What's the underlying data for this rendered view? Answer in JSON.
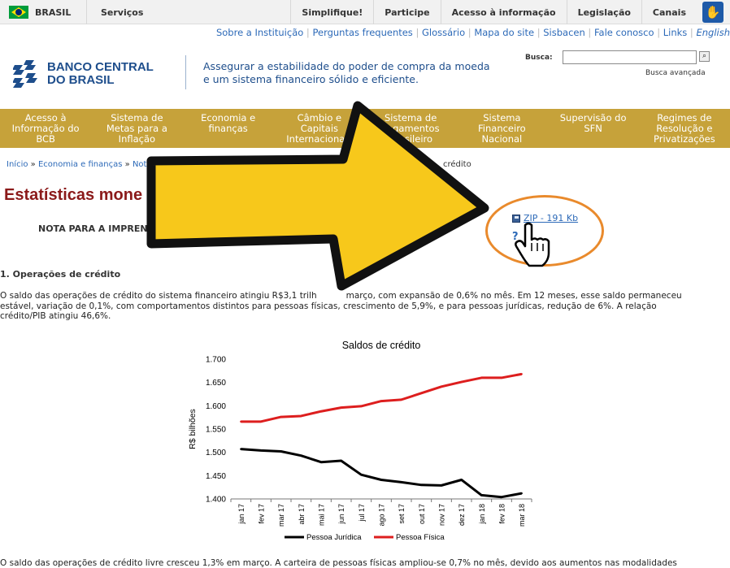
{
  "gov_bar": {
    "country": "BRASIL",
    "services": "Serviços",
    "links": [
      "Simplifique!",
      "Participe",
      "Acesso à informação",
      "Legislação",
      "Canais"
    ],
    "accessibility_icon": "vlibras-hand-icon"
  },
  "util_links": [
    "Sobre a Instituição",
    "Perguntas frequentes",
    "Glossário",
    "Mapa do site",
    "Sisbacen",
    "Fale conosco",
    "Links",
    "English"
  ],
  "header": {
    "logo_line1": "BANCO CENTRAL",
    "logo_line2": "DO BRASIL",
    "tagline_line1": "Assegurar a estabilidade do poder de compra da moeda",
    "tagline_line2": "e um sistema financeiro sólido e eficiente.",
    "search_label": "Busca:",
    "search_value": "",
    "search_advanced": "Busca avançada"
  },
  "main_nav": [
    [
      "Acesso à",
      "Informação do",
      "BCB"
    ],
    [
      "Sistema de",
      "Metas para a",
      "Inflação"
    ],
    [
      "Economia e",
      "finanças",
      ""
    ],
    [
      "Câmbio e",
      "Capitais",
      "Internacionais"
    ],
    [
      "Sistema de",
      "Pagamentos",
      "Brasileiro"
    ],
    [
      "Sistema",
      "Financeiro",
      "Nacional"
    ],
    [
      "Supervisão do",
      "SFN",
      ""
    ],
    [
      "Regimes de",
      "Resolução e",
      "Privatizações"
    ]
  ],
  "breadcrumb": {
    "items": [
      "Início",
      "Economia e finanças",
      "Nota"
    ],
    "tail": "crédito"
  },
  "page": {
    "title": "Estatísticas mone",
    "press_note": "NOTA PARA A IMPRENS",
    "zip_link": "ZIP - 191 Kb",
    "help": "?",
    "section1": "1. Operações de crédito",
    "para1_line1": "O saldo das operações de crédito do sistema financeiro atingiu R$3,1 trilh",
    "para1_line1b": "março, com expansão de 0,6% no mês. Em 12 meses, esse saldo permaneceu",
    "para1_line2": "estável, variação de 0,1%, com comportamentos distintos para pessoas f",
    "para1_line2b": "ísicas, crescimento de 5,9%, e para pessoas jurídicas, redução de 6%. A relação",
    "para1_line3": "crédito/PIB atingiu 46,6%.",
    "para2": "O saldo das operações de crédito livre cresceu 1,3% em março. A carteira de pessoas físicas ampliou-se 0,7% no mês, devido aos aumentos nas modalidades"
  },
  "colors": {
    "nav_gold": "#c6a23a",
    "title_red": "#8b1a1a",
    "link_blue": "#2d6ab8",
    "arrow_yellow": "#f7c81b",
    "ring_orange": "#e98a2c",
    "series_pj": "#000000",
    "series_pf": "#dd1e1e"
  },
  "chart_data": {
    "type": "line",
    "title": "Saldos de crédito",
    "ylabel": "R$ bilhões",
    "xlabel": "",
    "ylim": [
      1400,
      1700
    ],
    "yticks": [
      "1.400",
      "1.450",
      "1.500",
      "1.550",
      "1.600",
      "1.650",
      "1.700"
    ],
    "categories": [
      "jan 17",
      "fev 17",
      "mar 17",
      "abr 17",
      "mai 17",
      "jun 17",
      "jul 17",
      "ago 17",
      "set 17",
      "out 17",
      "nov 17",
      "dez 17",
      "jan 18",
      "fev 18",
      "mar 18"
    ],
    "series": [
      {
        "name": "Pessoa Jurídica",
        "values": [
          1507,
          1504,
          1502,
          1493,
          1479,
          1482,
          1452,
          1441,
          1436,
          1430,
          1429,
          1441,
          1408,
          1404,
          1412
        ]
      },
      {
        "name": "Pessoa Física",
        "values": [
          1566,
          1566,
          1576,
          1578,
          1588,
          1596,
          1599,
          1610,
          1613,
          1627,
          1641,
          1651,
          1660,
          1660,
          1668
        ]
      }
    ],
    "legend_position": "bottom",
    "grid": false
  }
}
